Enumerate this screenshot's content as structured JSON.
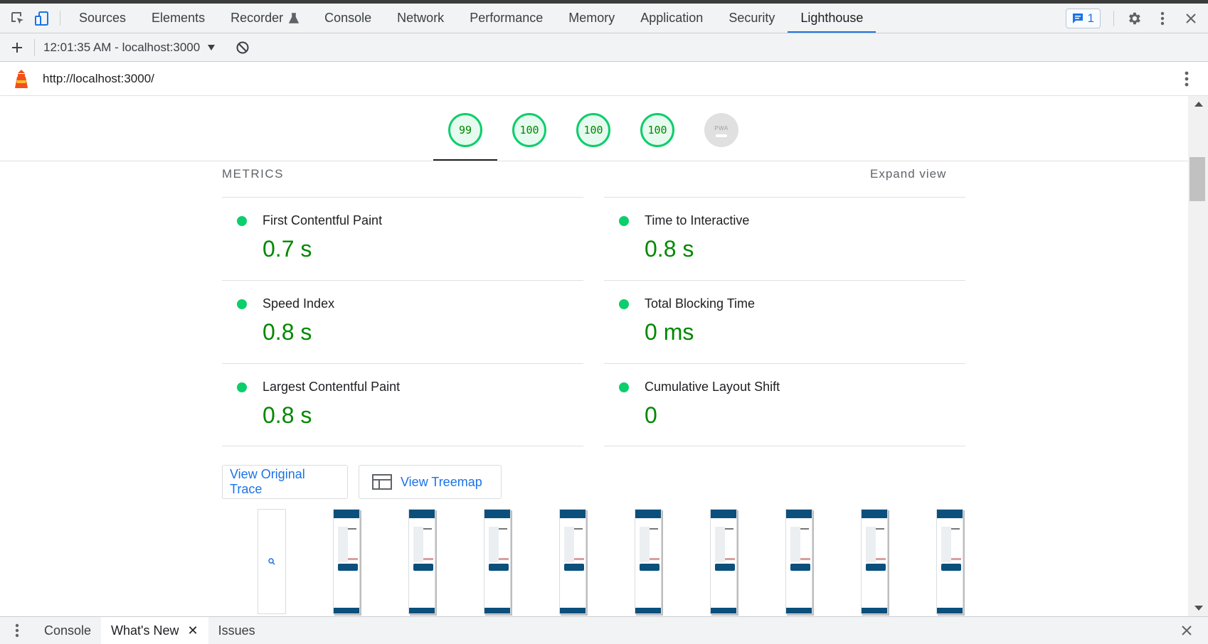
{
  "tabs": [
    {
      "label": "Sources",
      "active": false
    },
    {
      "label": "Elements",
      "active": false
    },
    {
      "label": "Recorder",
      "active": false
    },
    {
      "label": "Console",
      "active": false
    },
    {
      "label": "Network",
      "active": false
    },
    {
      "label": "Performance",
      "active": false
    },
    {
      "label": "Memory",
      "active": false
    },
    {
      "label": "Application",
      "active": false
    },
    {
      "label": "Security",
      "active": false
    },
    {
      "label": "Lighthouse",
      "active": true
    }
  ],
  "issues_count": "1",
  "lighthouse_bar": {
    "report_label": "12:01:35 AM - localhost:3000"
  },
  "report_url": "http://localhost:3000/",
  "scores": [
    {
      "category": "performance",
      "value": "99"
    },
    {
      "category": "accessibility",
      "value": "100"
    },
    {
      "category": "best-practices",
      "value": "100"
    },
    {
      "category": "seo",
      "value": "100"
    },
    {
      "category": "pwa",
      "value": "PWA"
    }
  ],
  "metrics_section": {
    "title": "METRICS",
    "expand_label": "Expand view"
  },
  "metrics": [
    {
      "label": "First Contentful Paint",
      "value": "0.7 s",
      "status": "pass"
    },
    {
      "label": "Time to Interactive",
      "value": "0.8 s",
      "status": "pass"
    },
    {
      "label": "Speed Index",
      "value": "0.8 s",
      "status": "pass"
    },
    {
      "label": "Total Blocking Time",
      "value": "0 ms",
      "status": "pass"
    },
    {
      "label": "Largest Contentful Paint",
      "value": "0.8 s",
      "status": "pass"
    },
    {
      "label": "Cumulative Layout Shift",
      "value": "0",
      "status": "pass"
    }
  ],
  "buttons": {
    "view_trace": "View Original Trace",
    "view_treemap": "View Treemap"
  },
  "drawer": {
    "tabs": [
      {
        "label": "Console",
        "active": false
      },
      {
        "label": "What's New",
        "active": true
      },
      {
        "label": "Issues",
        "active": false
      }
    ]
  },
  "colors": {
    "pass": "#0cce6b",
    "pass_text": "#008800",
    "accent": "#1a73e8"
  }
}
